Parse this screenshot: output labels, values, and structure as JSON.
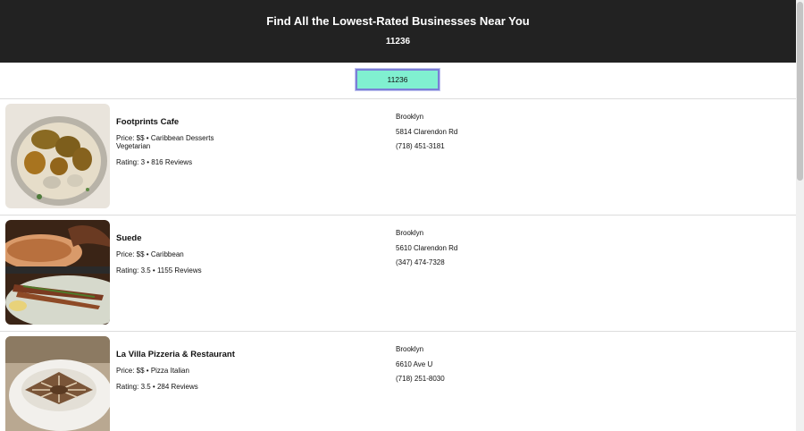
{
  "header": {
    "title": "Find All the Lowest-Rated Businesses Near You",
    "zip": "11236"
  },
  "search": {
    "value": "11236"
  },
  "businesses": [
    {
      "name": "Footprints Cafe",
      "price_line": "Price: $$ • Caribbean Desserts",
      "categories_extra": "Vegetarian",
      "rating_line": "Rating: 3 • 816 Reviews",
      "city": "Brooklyn",
      "address": "5814 Clarendon Rd",
      "phone": "(718) 451-3181"
    },
    {
      "name": "Suede",
      "price_line": "Price: $$ • Caribbean",
      "categories_extra": "",
      "rating_line": "Rating: 3.5 • 1155 Reviews",
      "city": "Brooklyn",
      "address": "5610 Clarendon Rd",
      "phone": "(347) 474-7328"
    },
    {
      "name": "La Villa Pizzeria & Restaurant",
      "price_line": "Price: $$ • Pizza Italian",
      "categories_extra": "",
      "rating_line": "Rating: 3.5 • 284 Reviews",
      "city": "Brooklyn",
      "address": "6610 Ave U",
      "phone": "(718) 251-8030"
    }
  ]
}
